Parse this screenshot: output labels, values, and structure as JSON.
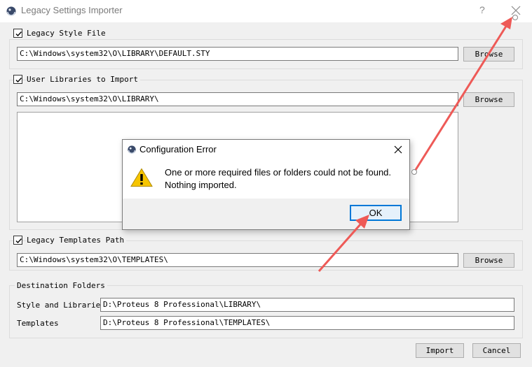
{
  "window": {
    "title": "Legacy Settings Importer",
    "help_glyph": "?",
    "close_icon": "close-icon"
  },
  "style_file": {
    "label": "Legacy Style File",
    "checked": true,
    "path": "C:\\Windows\\system32\\O\\LIBRARY\\DEFAULT.STY",
    "browse": "Browse"
  },
  "libraries": {
    "label": "User Libraries to Import",
    "checked": true,
    "path": "C:\\Windows\\system32\\O\\LIBRARY\\",
    "browse": "Browse"
  },
  "templates": {
    "label": "Legacy Templates Path",
    "checked": true,
    "path": "C:\\Windows\\system32\\O\\TEMPLATES\\",
    "browse": "Browse"
  },
  "destination": {
    "group_label": "Destination Folders",
    "style_label": "Style and Libraries",
    "style_path": "D:\\Proteus 8 Professional\\LIBRARY\\",
    "templates_label": "Templates",
    "templates_path": "D:\\Proteus 8 Professional\\TEMPLATES\\"
  },
  "footer": {
    "import": "Import",
    "cancel": "Cancel"
  },
  "error_dialog": {
    "title": "Configuration Error",
    "message_line1": "One or more required files or folders could not be found.",
    "message_line2": "Nothing imported.",
    "ok": "OK",
    "icon": "warning-icon"
  },
  "colors": {
    "annotation_arrow": "#ee5a57",
    "focus_border": "#0078d7",
    "warning_yellow": "#f6c500"
  }
}
